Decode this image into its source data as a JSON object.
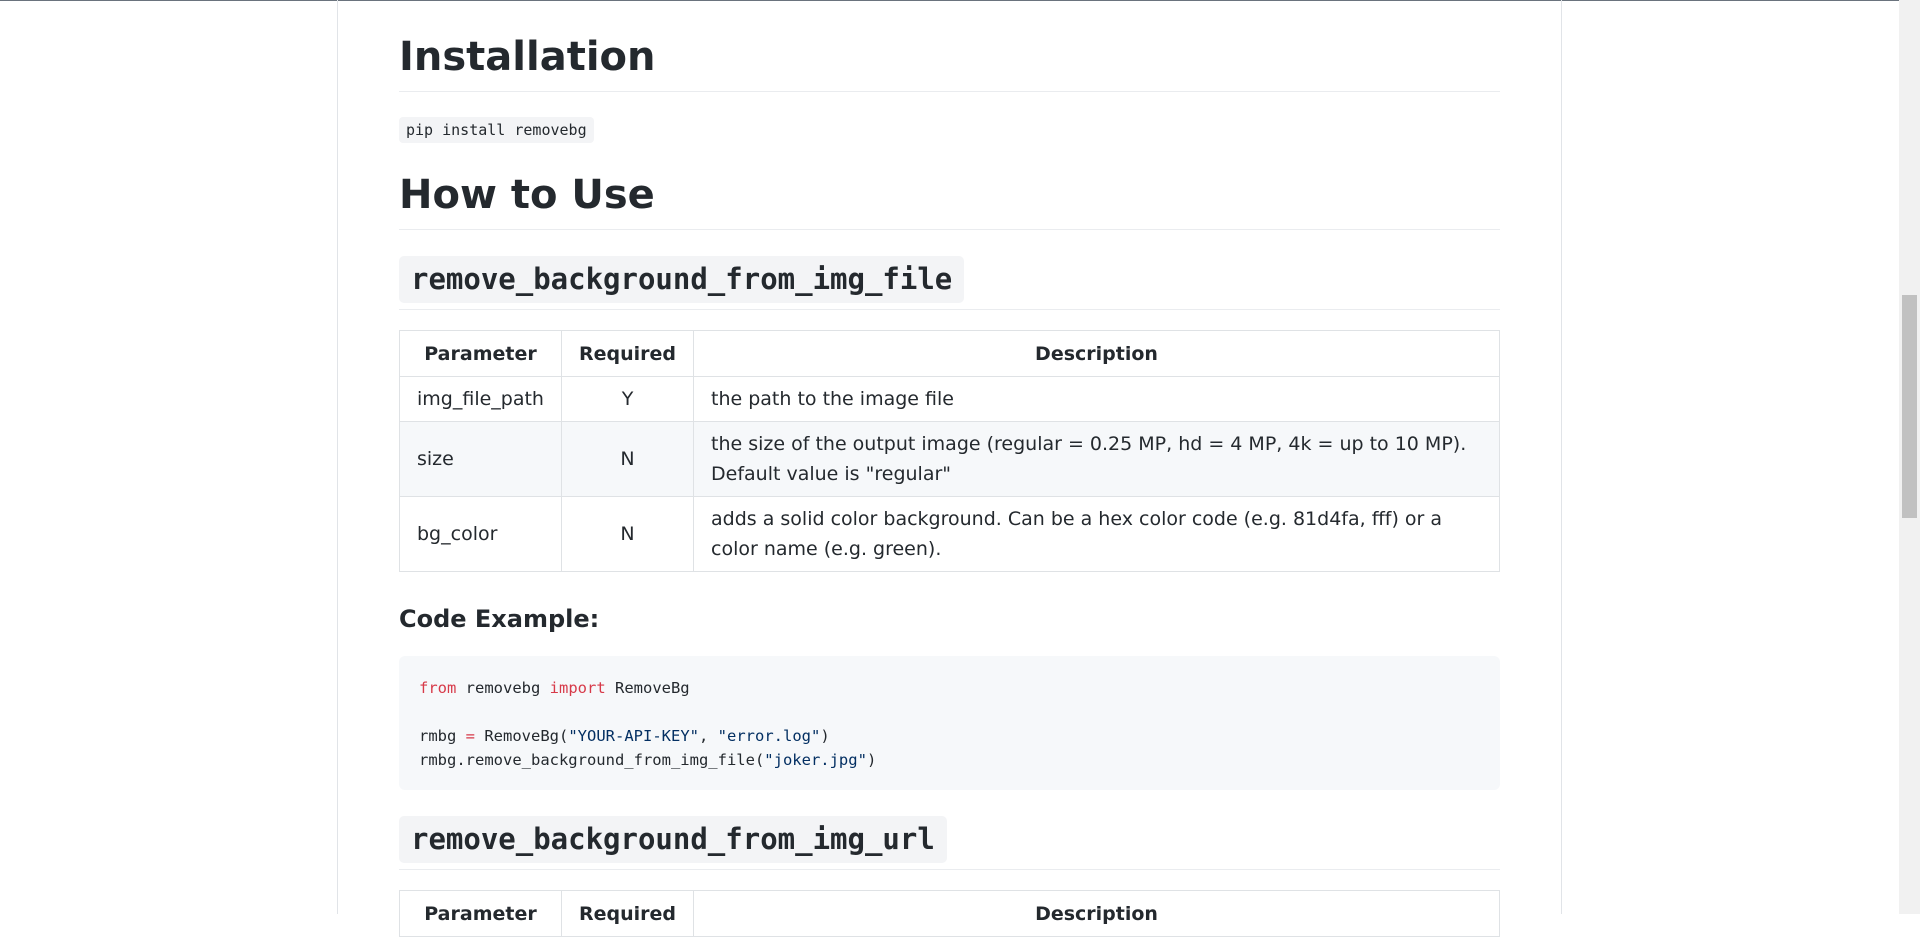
{
  "installation": {
    "heading": "Installation",
    "command": "pip install removebg"
  },
  "how_to_use": {
    "heading": "How to Use"
  },
  "section1": {
    "title": "remove_background_from_img_file",
    "table": {
      "headers": [
        "Parameter",
        "Required",
        "Description"
      ],
      "rows": [
        {
          "param": "img_file_path",
          "required": "Y",
          "description": "the path to the image file"
        },
        {
          "param": "size",
          "required": "N",
          "description": "the size of the output image (regular = 0.25 MP, hd = 4 MP, 4k = up to 10 MP). Default value is \"regular\""
        },
        {
          "param": "bg_color",
          "required": "N",
          "description": "adds a solid color background. Can be a hex color code (e.g. 81d4fa, fff) or a color name (e.g. green)."
        }
      ]
    },
    "example_heading": "Code Example:",
    "code": {
      "line1_kw1": "from",
      "line1_mid": " removebg ",
      "line1_kw2": "import",
      "line1_end": " RemoveBg",
      "line3_a": "rmbg ",
      "line3_op": "=",
      "line3_b": " RemoveBg(",
      "line3_s1": "\"YOUR-API-KEY\"",
      "line3_c": ", ",
      "line3_s2": "\"error.log\"",
      "line3_d": ")",
      "line4_a": "rmbg.remove_background_from_img_file(",
      "line4_s": "\"joker.jpg\"",
      "line4_b": ")"
    }
  },
  "section2": {
    "title": "remove_background_from_img_url",
    "table": {
      "headers": [
        "Parameter",
        "Required",
        "Description"
      ]
    }
  },
  "colors": {
    "keyword": "#d73a49",
    "string": "#032f62",
    "code_bg": "#f6f8fa"
  }
}
